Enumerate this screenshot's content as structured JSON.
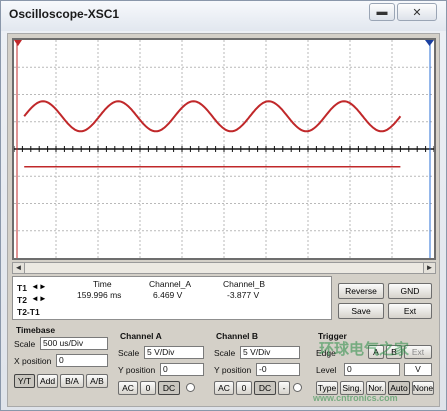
{
  "window": {
    "title": "Oscilloscope-XSC1",
    "minimize_glyph": "▬",
    "close_glyph": "✕"
  },
  "colors": {
    "trace_a": "#c0282a",
    "trace_b": "#c0282a",
    "grid": "#b9b9b9",
    "axis": "#111111",
    "cursor_t1": "#c0282a",
    "cursor_t2": "#2a6fd6",
    "marker_t1": "#c0282a",
    "marker_t2": "#1a3fa0"
  },
  "chart_data": {
    "type": "line",
    "title": "",
    "xlabel": "",
    "ylabel": "",
    "time_per_div": "500 us/Div",
    "volts_per_div": "5 V/Div",
    "grid": true,
    "x_divisions": 10,
    "y_divisions": 8,
    "series": [
      {
        "cycles_visible": 5,
        "amplitude_div": 0.55,
        "offset_div": 1.2,
        "shape": "sine"
      },
      {
        "cycles_visible": 0,
        "amplitude_div": 0,
        "offset_div": -0.65,
        "shape": "dc"
      }
    ]
  },
  "cursors": {
    "t1_label": "T1",
    "t2_label": "T2",
    "t2t1_label": "T2-T1",
    "arrows": "◄► "
  },
  "readout": {
    "headers": {
      "time": "Time",
      "channel_a": "Channel_A",
      "channel_b": "Channel_B"
    },
    "t1": {
      "time": "159.996 ms",
      "channel_a": "6.469 V",
      "channel_b": "-3.877 V"
    }
  },
  "buttons": {
    "reverse": "Reverse",
    "save": "Save",
    "ground": "GND",
    "ext_trigger": "Ext"
  },
  "timebase": {
    "label": "Timebase",
    "scale_label": "Scale",
    "scale_value": "500 us/Div",
    "xpos_label": "X position",
    "xpos_value": "0",
    "modes": [
      "Y/T",
      "Add",
      "B/A",
      "A/B"
    ]
  },
  "channel_a": {
    "label": "Channel A",
    "scale_label": "Scale",
    "scale_value": "5  V/Div",
    "ypos_label": "Y position",
    "ypos_value": "0",
    "coupling": [
      "AC",
      "0",
      "DC"
    ]
  },
  "channel_b": {
    "label": "Channel B",
    "scale_label": "Scale",
    "scale_value": "5  V/Div",
    "ypos_label": "Y position",
    "ypos_value": "-0",
    "coupling": [
      "AC",
      "0",
      "DC",
      "-"
    ]
  },
  "trigger": {
    "label": "Trigger",
    "edge_label": "Edge",
    "sources": [
      "A",
      "B",
      "Ext"
    ],
    "level_label": "Level",
    "level_value": "0",
    "level_unit": "V",
    "types": [
      "Type",
      "Sing.",
      "Nor.",
      "Auto",
      "None"
    ]
  },
  "watermark": {
    "cn": "环球电气之家",
    "url": "www.cntronics.com"
  }
}
